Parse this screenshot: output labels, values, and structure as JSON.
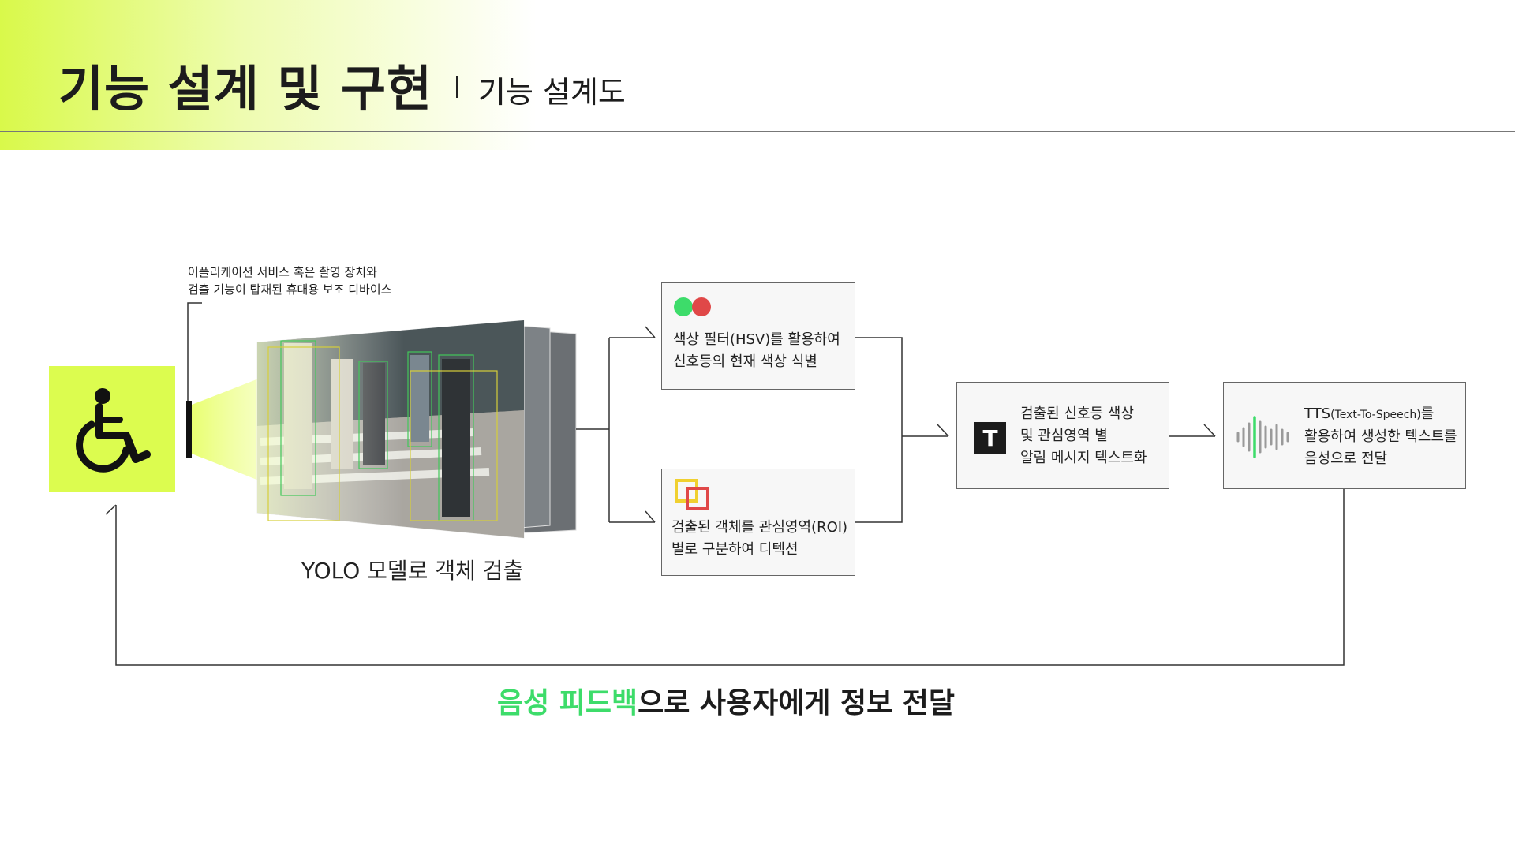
{
  "header": {
    "title": "기능 설계 및 구현",
    "subtitle": "기능 설계도"
  },
  "device": {
    "caption_line1": "어플리케이션 서비스 혹은 촬영 장치와",
    "caption_line2": "검출 기능이 탑재된 휴대용 보조 디바이스"
  },
  "detection": {
    "caption": "YOLO 모델로 객체 검출"
  },
  "color_box": {
    "line1": "색상 필터(HSV)를 활용하여",
    "line2": "신호등의 현재 색상 식별"
  },
  "roi_box": {
    "line1": "검출된 객체를 관심영역(ROI)",
    "line2": "별로 구분하여 디텍션"
  },
  "text_box": {
    "icon_letter": "T",
    "line1": "검출된 신호등 색상",
    "line2": "및 관심영역 별",
    "line3": "알림 메시지 텍스트화"
  },
  "tts_box": {
    "line1_main": "TTS",
    "line1_small": "(Text-To-Speech)",
    "line1_tail": "를",
    "line2": "활용하여 생성한 텍스트를",
    "line3": "음성으로 전달"
  },
  "feedback": {
    "accent": "음성 피드백",
    "rest": "으로 사용자에게 정보 전달"
  },
  "icons": [
    "wheelchair-icon",
    "traffic-light-dots-icon",
    "roi-squares-icon",
    "text-t-icon",
    "sound-wave-icon"
  ],
  "colors": {
    "accent_lime": "#dcfc4f",
    "accent_green": "#3ddc6a",
    "signal_red": "#e04848",
    "roi_yellow": "#f0d030",
    "roi_red": "#e04848"
  }
}
